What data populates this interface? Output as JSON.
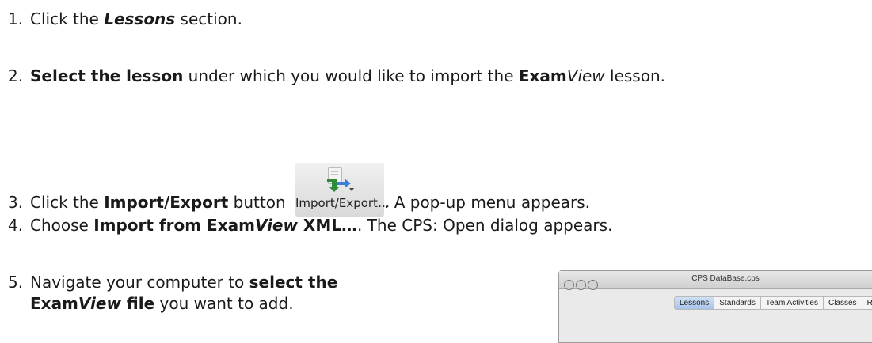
{
  "steps": [
    {
      "num": "1.",
      "a": "Click the ",
      "b": "Lessons",
      "c": " section."
    },
    {
      "num": "2.",
      "bold1": "Select the lesson",
      "t1": " under which you would like to import the ",
      "bold2": "Exam",
      "ital": "View",
      "t2": " lesson."
    },
    {
      "num": "3.",
      "t1": "Click the ",
      "bold": "Import/Export",
      "t2": " button ",
      "t3": ". A pop-up menu appears."
    },
    {
      "num": "4.",
      "t1": "Choose ",
      "bold1": "Import from Exam",
      "ital": "View",
      "bold2": " XML…",
      "t2": ". The CPS: Open dialog appears."
    },
    {
      "num": "5.",
      "t1": "Navigate your computer to ",
      "bold1": "select the",
      "bold2": "Exam",
      "ital": "View",
      "bold3": " file",
      "t2": " you want to add."
    }
  ],
  "import_button": {
    "label": "Import/Export…",
    "icon": "import-export-icon"
  },
  "window": {
    "title": "CPS DataBase.cps",
    "tabs": [
      "Lessons",
      "Standards",
      "Team Activities",
      "Classes",
      "Reports"
    ],
    "active_tab": "Lessons"
  }
}
